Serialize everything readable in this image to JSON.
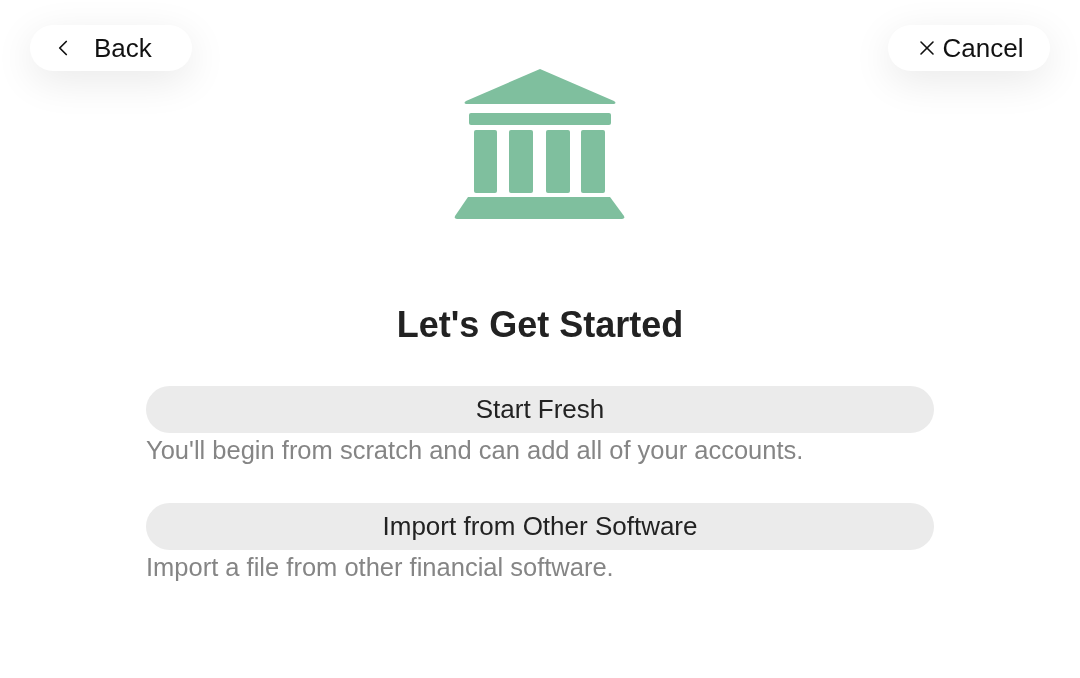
{
  "nav": {
    "back": {
      "label": "Back"
    },
    "cancel": {
      "label": "Cancel"
    }
  },
  "title": "Let's Get Started",
  "options": [
    {
      "label": "Start Fresh",
      "description": "You'll begin from scratch and can add all of your accounts."
    },
    {
      "label": "Import from Other Software",
      "description": "Import a file from other financial software."
    }
  ]
}
